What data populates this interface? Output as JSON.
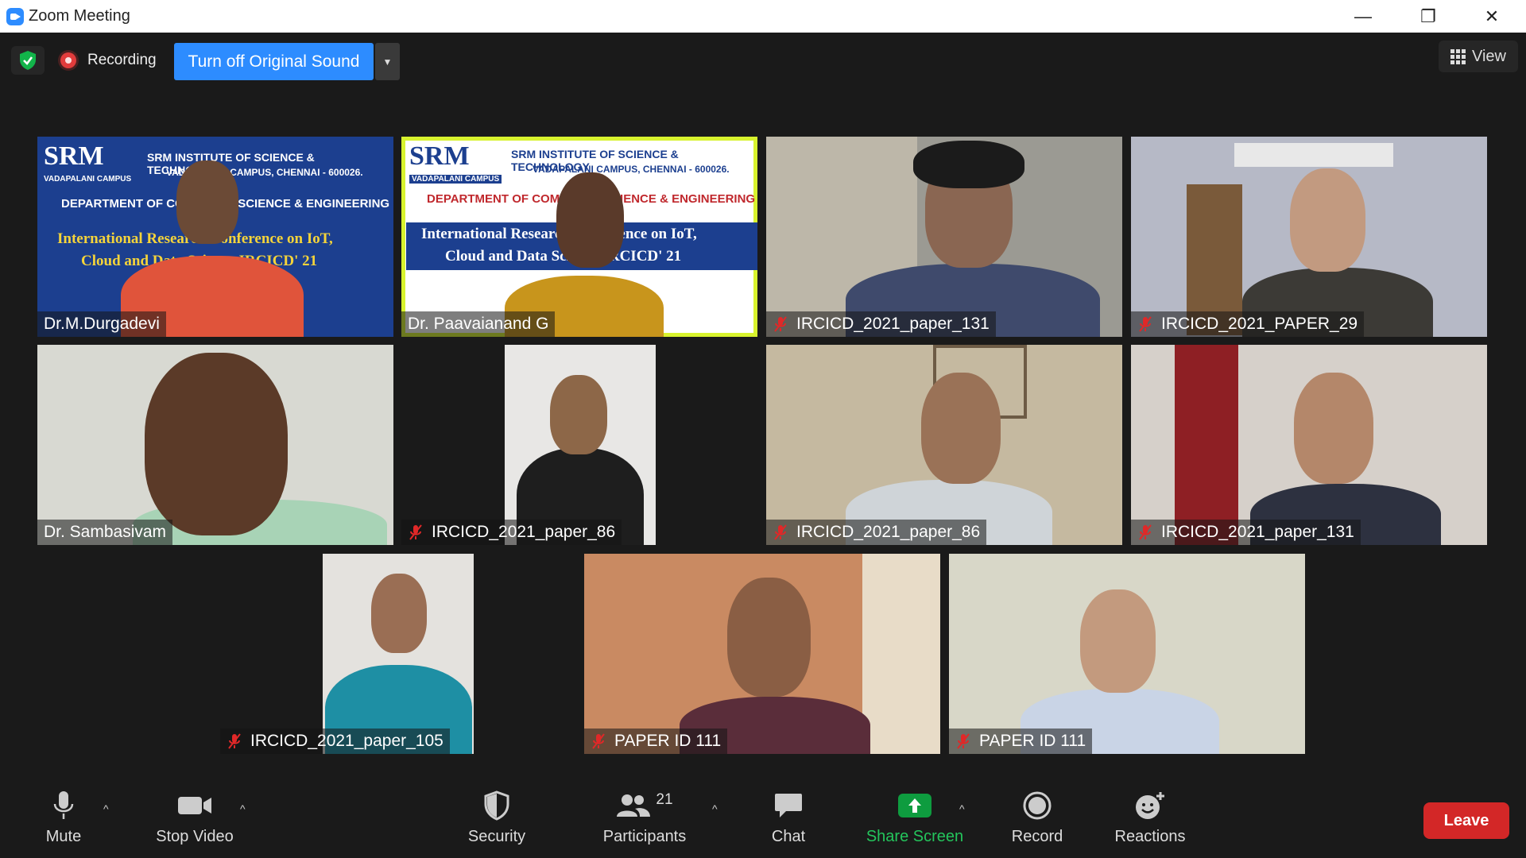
{
  "window": {
    "title": "Zoom Meeting",
    "minimize_glyph": "—",
    "restore_glyph": "❐",
    "close_glyph": "✕"
  },
  "top_bar": {
    "security_status_icon": "shield-check-icon",
    "recording_label": "Recording",
    "original_sound_button": "Turn off Original Sound",
    "view_button": "View"
  },
  "srm_banner": {
    "logo": "SRM",
    "institute": "SRM INSTITUTE OF SCIENCE & TECHNOLOGY",
    "campus_line": "VADAPALANI CAMPUS, CHENNAI - 600026.",
    "campus_badge": "VADAPALANI CAMPUS",
    "department": "DEPARTMENT OF COMPUTER SCIENCE & ENGINEERING",
    "conference_line1": "International Research Conference on IoT,",
    "conference_line2": "Cloud and Data Science IRCICD' 21"
  },
  "participants": [
    {
      "name": "Dr.M.Durgadevi",
      "muted": false,
      "active": false
    },
    {
      "name": "Dr. Paavaianand G",
      "muted": false,
      "active": true
    },
    {
      "name": "IRCICD_2021_paper_131",
      "muted": true,
      "active": false
    },
    {
      "name": "IRCICD_2021_PAPER_29",
      "muted": true,
      "active": false
    },
    {
      "name": "Dr. Sambasivam",
      "muted": false,
      "active": false
    },
    {
      "name": "IRCICD_2021_paper_86",
      "muted": true,
      "active": false
    },
    {
      "name": "IRCICD_2021_paper_86",
      "muted": true,
      "active": false
    },
    {
      "name": "IRCICD_2021_paper_131",
      "muted": true,
      "active": false
    },
    {
      "name": "IRCICD_2021_paper_105",
      "muted": true,
      "active": false
    },
    {
      "name": "PAPER ID 111",
      "muted": true,
      "active": false
    },
    {
      "name": "PAPER ID 111",
      "muted": true,
      "active": false
    }
  ],
  "toolbar": {
    "mute": "Mute",
    "stop_video": "Stop Video",
    "security": "Security",
    "participants": "Participants",
    "participant_count": "21",
    "chat": "Chat",
    "share_screen": "Share Screen",
    "record": "Record",
    "reactions": "Reactions",
    "leave": "Leave",
    "caret": "^"
  },
  "colors": {
    "accent": "#2d8cff",
    "active_speaker": "#d8f32e",
    "leave": "#d32727",
    "share": "#0e9c3f"
  }
}
